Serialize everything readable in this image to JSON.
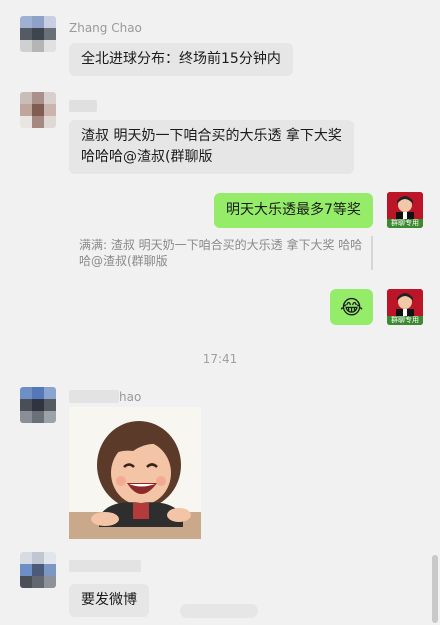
{
  "messages": {
    "m1": {
      "sender": "Zhang Chao",
      "text": "全北进球分布：终场前15分钟内"
    },
    "m2": {
      "text": "渣叔 明天奶一下咱合买的大乐透 拿下大奖 哈哈哈@渣叔(群聊版"
    },
    "m3": {
      "text": "明天大乐透最多7等奖",
      "quote": "满满: 渣叔 明天奶一下咱合买的大乐透 拿下大奖 哈哈哈@渣叔(群聊版",
      "avatar_badge": "群聊专用"
    },
    "m4": {
      "emoji": "😂",
      "avatar_badge": "群聊专用"
    },
    "time": "17:41",
    "m5": {
      "sender_suffix": "hao",
      "sticker": "laughing-cartoon-woman-sticker"
    },
    "m6": {
      "text": "要发微博"
    }
  },
  "colors": {
    "outgoing": "#95ec69",
    "incoming": "#e6e6e6",
    "background": "#f1f1f1"
  }
}
